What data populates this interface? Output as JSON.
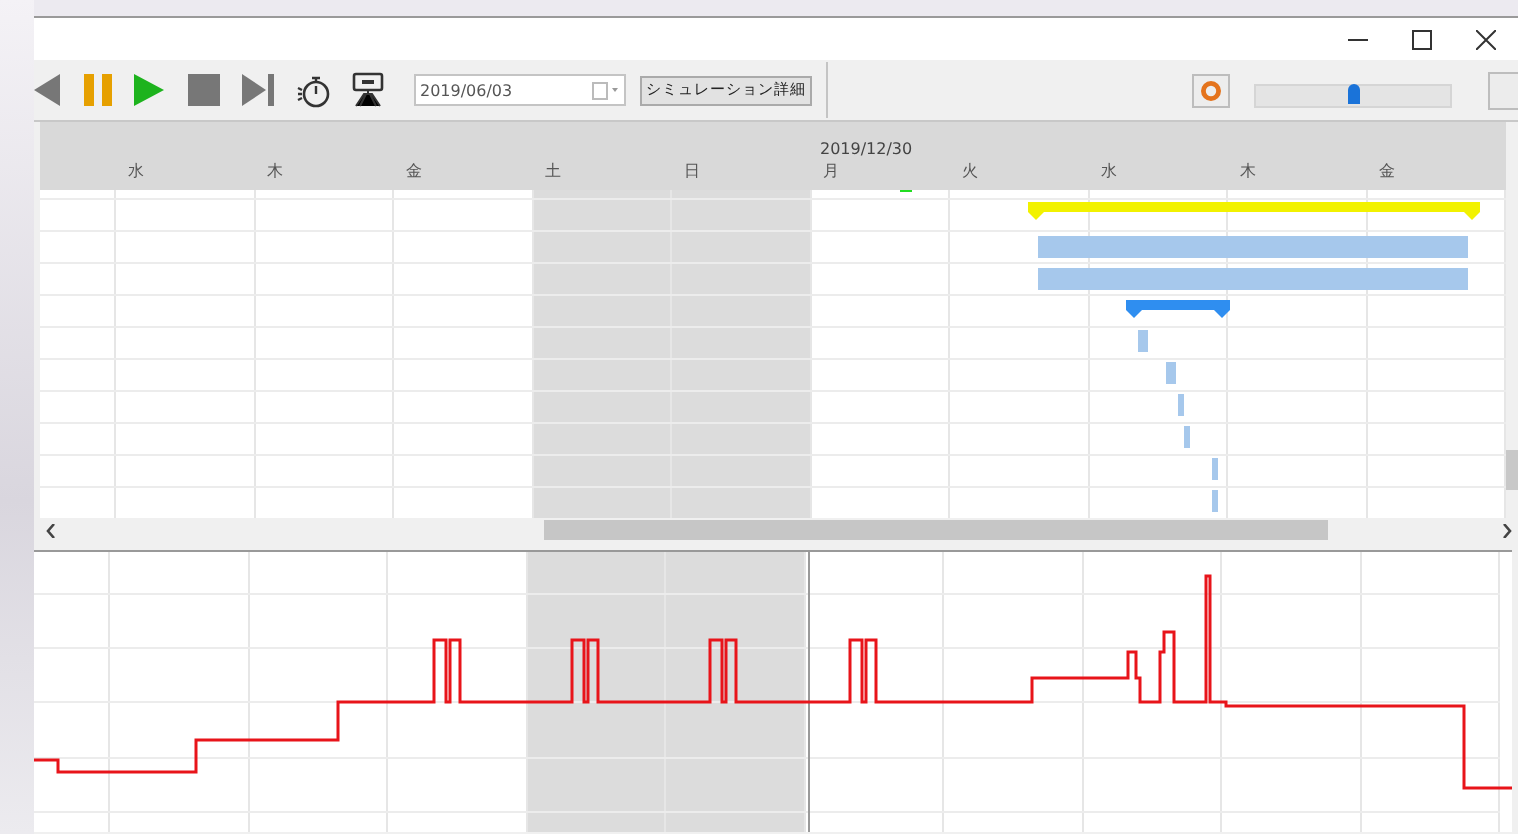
{
  "toolbar": {
    "date_field": {
      "value": "2019/06/03"
    },
    "detail_button": {
      "label": "シミュレーション詳細"
    },
    "zoom_slider": {
      "level": 0.5
    }
  },
  "gantt": {
    "header_date": "2019/12/30",
    "days": [
      {
        "weekend": false
      },
      {
        "label": "水",
        "weekend": false
      },
      {
        "label": "木",
        "weekend": false
      },
      {
        "label": "金",
        "weekend": false
      },
      {
        "label": "土",
        "weekend": true
      },
      {
        "label": "日",
        "weekend": true
      },
      {
        "label": "月",
        "weekend": false
      },
      {
        "label": "火",
        "weekend": false
      },
      {
        "label": "水",
        "weekend": false
      },
      {
        "label": "木",
        "weekend": false
      },
      {
        "label": "金",
        "weekend": false
      }
    ]
  }
}
